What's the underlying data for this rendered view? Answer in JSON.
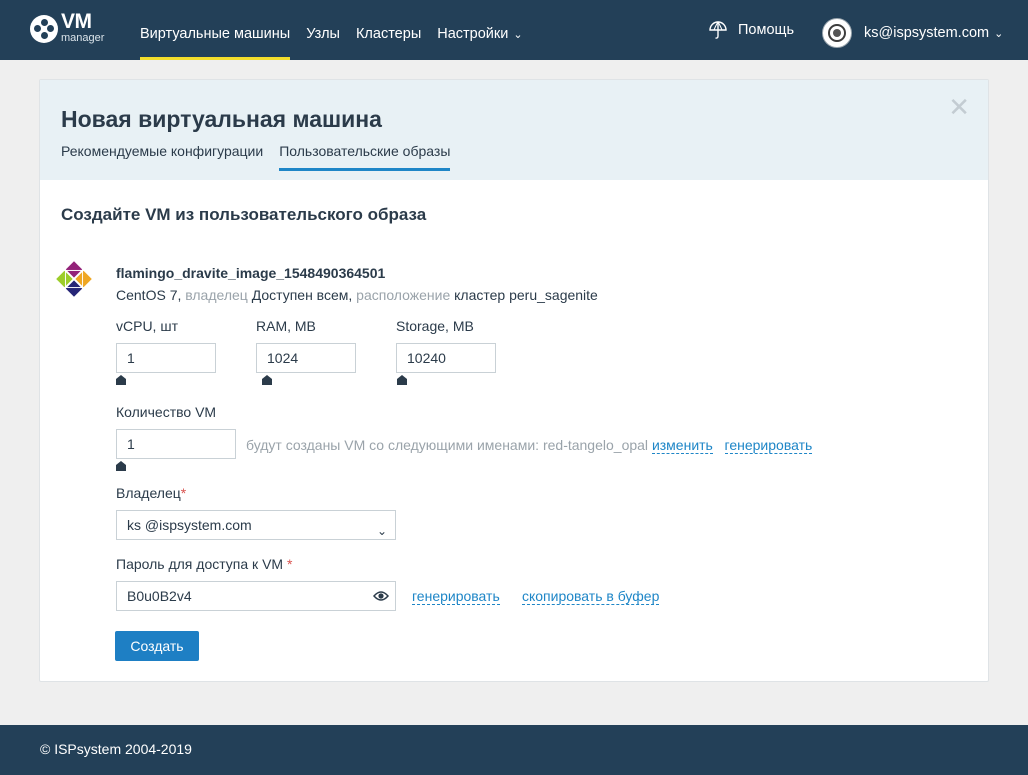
{
  "header": {
    "logo_main": "VM",
    "logo_sub": "manager",
    "nav": [
      {
        "label": "Виртуальные машины",
        "active": true
      },
      {
        "label": "Узлы",
        "active": false
      },
      {
        "label": "Кластеры",
        "active": false
      },
      {
        "label": "Настройки",
        "active": false,
        "dropdown": true
      }
    ],
    "help_label": "Помощь",
    "user_email": "ks@ispsystem.com"
  },
  "modal": {
    "title": "Новая виртуальная машина",
    "close_icon": "close-icon",
    "tabs": [
      {
        "label": "Рекомендуемые конфигурации",
        "active": false
      },
      {
        "label": "Пользовательские образы",
        "active": true
      }
    ],
    "section_title": "Создайте VM из пользовательского образа",
    "image": {
      "icon": "centos-icon",
      "name": "flamingo_dravite_image_1548490364501",
      "os": "CentOS 7,",
      "owner_label": "владелец",
      "owner_value": "Доступен всем,",
      "location_label": "расположение",
      "location_value": "кластер peru_sagenite"
    },
    "resources": {
      "vcpu_label": "vCPU, шт",
      "vcpu_value": "1",
      "ram_label": "RAM, MB",
      "ram_value": "1024",
      "storage_label": "Storage, MB",
      "storage_value": "10240"
    },
    "count": {
      "label": "Количество VM",
      "value": "1",
      "hint": "будут созданы VM со следующими именами:",
      "vm_name": "red-tangelo_opal",
      "change_link": "изменить",
      "generate_link": "генерировать"
    },
    "owner": {
      "label": "Владелец",
      "required_mark": "*",
      "value": "ks @ispsystem.com"
    },
    "password": {
      "label": "Пароль для доступа к VM",
      "required_mark": "*",
      "value": "B0u0B2v4",
      "generate_link": "генерировать",
      "copy_link": "скопировать в буфер"
    },
    "submit_label": "Создать"
  },
  "footer": {
    "copyright": "© ISPsystem 2004-2019"
  },
  "colors": {
    "topbar": "#234058",
    "accent_underline": "#f3de2c",
    "link": "#1e86c7",
    "button": "#1e7fc4",
    "modal_header_bg": "#e8f1f5"
  }
}
